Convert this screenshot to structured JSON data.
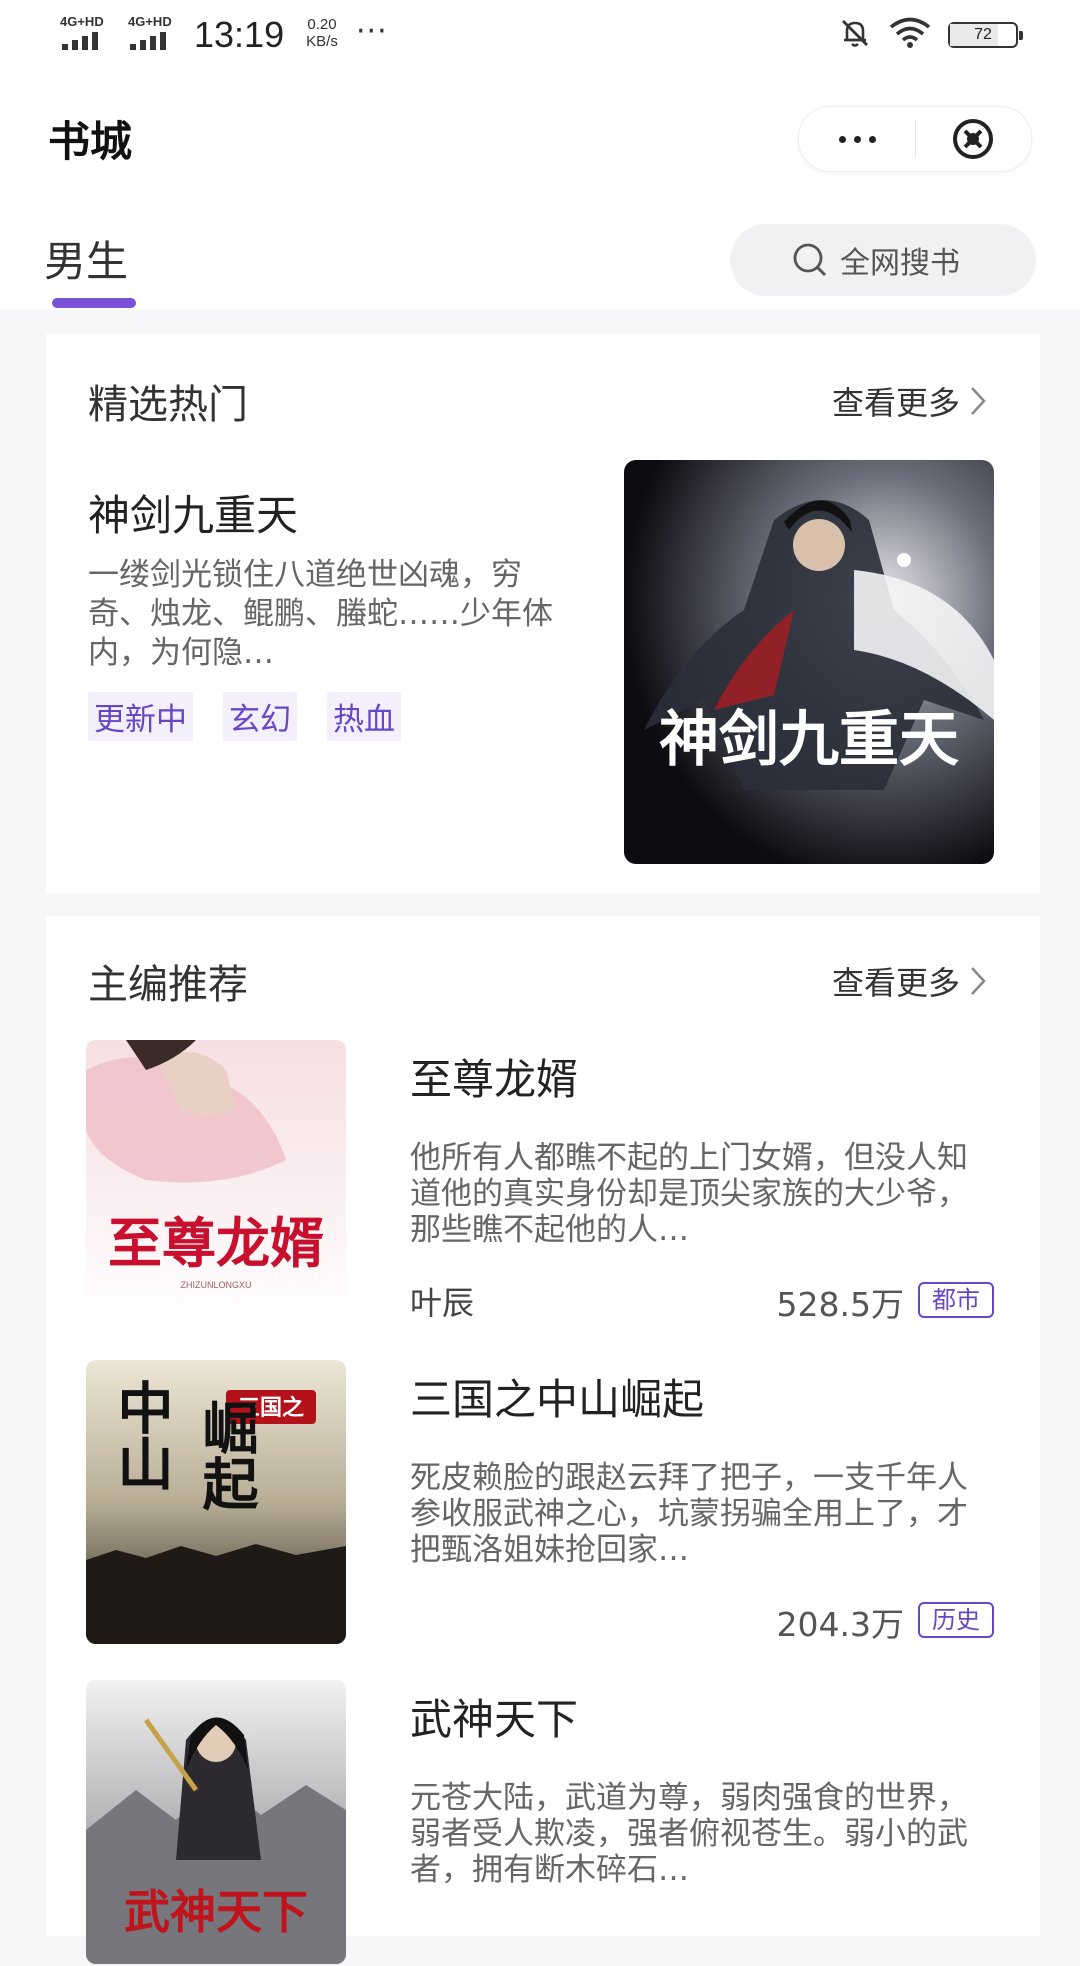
{
  "status_bar": {
    "network_1": "4G+HD",
    "network_2": "4G+HD",
    "time": "13:19",
    "speed_value": "0.20",
    "speed_unit": "KB/s",
    "more": "···",
    "battery": "72",
    "battery_level": 72
  },
  "header": {
    "title": "书城",
    "icons": [
      "more-dots-icon",
      "close-circle-icon"
    ]
  },
  "tabs": [
    {
      "label": "男生",
      "active": true
    }
  ],
  "search": {
    "label": "全网搜书",
    "icon": "search-icon"
  },
  "featured": {
    "section_title": "精选热门",
    "more_label": "查看更多",
    "book": {
      "title": "神剑九重天",
      "description": "一缕剑光锁住八道绝世凶魂，穷奇、烛龙、鲲鹏、螣蛇……少年体内，为何隐…",
      "tags": [
        "更新中",
        "玄幻",
        "热血"
      ],
      "cover_text": "神剑九重天"
    }
  },
  "recommend": {
    "section_title": "主编推荐",
    "more_label": "查看更多",
    "books": [
      {
        "title": "至尊龙婿",
        "description": "他所有人都瞧不起的上门女婿，但没人知道他的真实身份却是顶尖家族的大少爷，那些瞧不起他的人…",
        "author": "叶辰",
        "count": "528.5万",
        "genre": "都市",
        "cover_text": "至尊龙婿",
        "cover_subtext": "ZHIZUNLONGXU"
      },
      {
        "title": "三国之中山崛起",
        "description": "死皮赖脸的跟赵云拜了把子，一支千年人参收服武神之心，坑蒙拐骗全用上了，才把甄洛姐妹抢回家…",
        "author": "",
        "count": "204.3万",
        "genre": "历史",
        "cover_badge": "三国之",
        "cover_text_a": "中山",
        "cover_text_b": "崛起"
      },
      {
        "title": "武神天下",
        "description": "元苍大陆，武道为尊，弱肉强食的世界，弱者受人欺凌，强者俯视苍生。弱小的武者，拥有断木碎石…",
        "cover_text": "武神天下"
      }
    ]
  },
  "colors": {
    "accent": "#7a52d6",
    "tag_text": "#6747c7",
    "tag_bg": "#f3f0fb",
    "page_bg": "#f6f6f8"
  }
}
